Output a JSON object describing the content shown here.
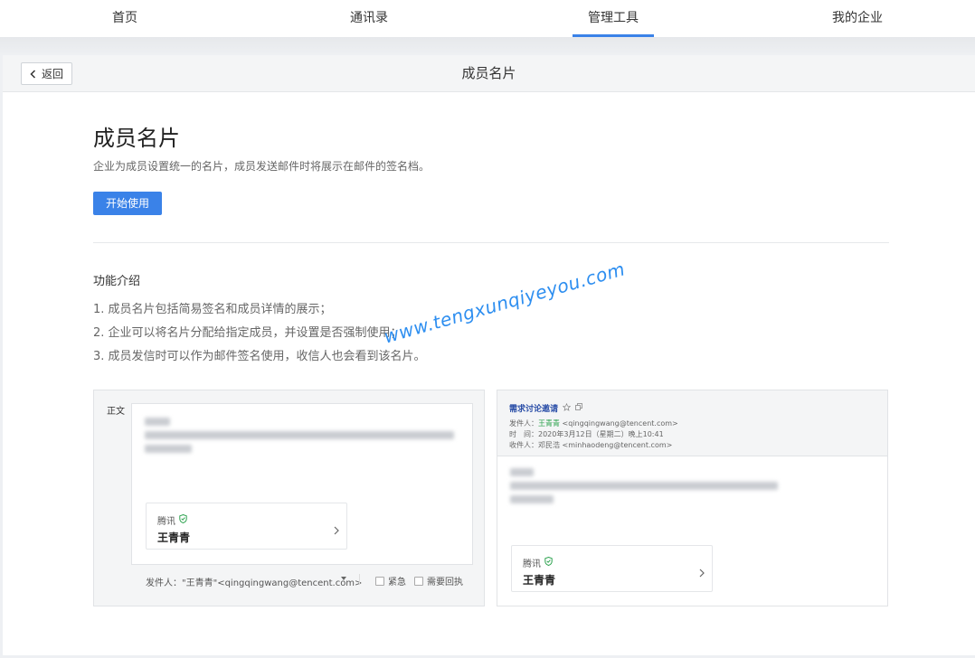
{
  "nav": {
    "tabs": [
      {
        "label": "首页"
      },
      {
        "label": "通讯录"
      },
      {
        "label": "管理工具"
      },
      {
        "label": "我的企业"
      }
    ],
    "active_index": 2,
    "accent": "#3a82e8"
  },
  "header": {
    "back_label": "返回",
    "title": "成员名片"
  },
  "main": {
    "title": "成员名片",
    "description": "企业为成员设置统一的名片，成员发送邮件时将展示在邮件的签名档。",
    "start_button": "开始使用",
    "features_title": "功能介绍",
    "features": [
      "1. 成员名片包括简易签名和成员详情的展示；",
      "2. 企业可以将名片分配给指定成员，并设置是否强制使用；",
      "3. 成员发信时可以作为邮件签名使用，收信人也会看到该名片。"
    ],
    "watermark": "www.tengxunqiyeyou.com"
  },
  "preview_compose": {
    "label": "正文",
    "signature": {
      "company": "腾讯",
      "name": "王青青"
    },
    "sender": "发件人：\"王青青\"<qingqingwang@tencent.com>",
    "urgent_label": "紧急",
    "receipt_label": "需要回执"
  },
  "preview_read": {
    "subject": "需求讨论邀请",
    "from_label": "发件人：",
    "from_name": "王青青",
    "from_email": "<qingqingwang@tencent.com>",
    "time_label": "时　间：",
    "time_value": "2020年3月12日（星期二）晚上10:41",
    "to_label": "收件人：",
    "to_value": "邓民浩 <minhaodeng@tencent.com>",
    "signature": {
      "company": "腾讯",
      "name": "王青青"
    }
  }
}
